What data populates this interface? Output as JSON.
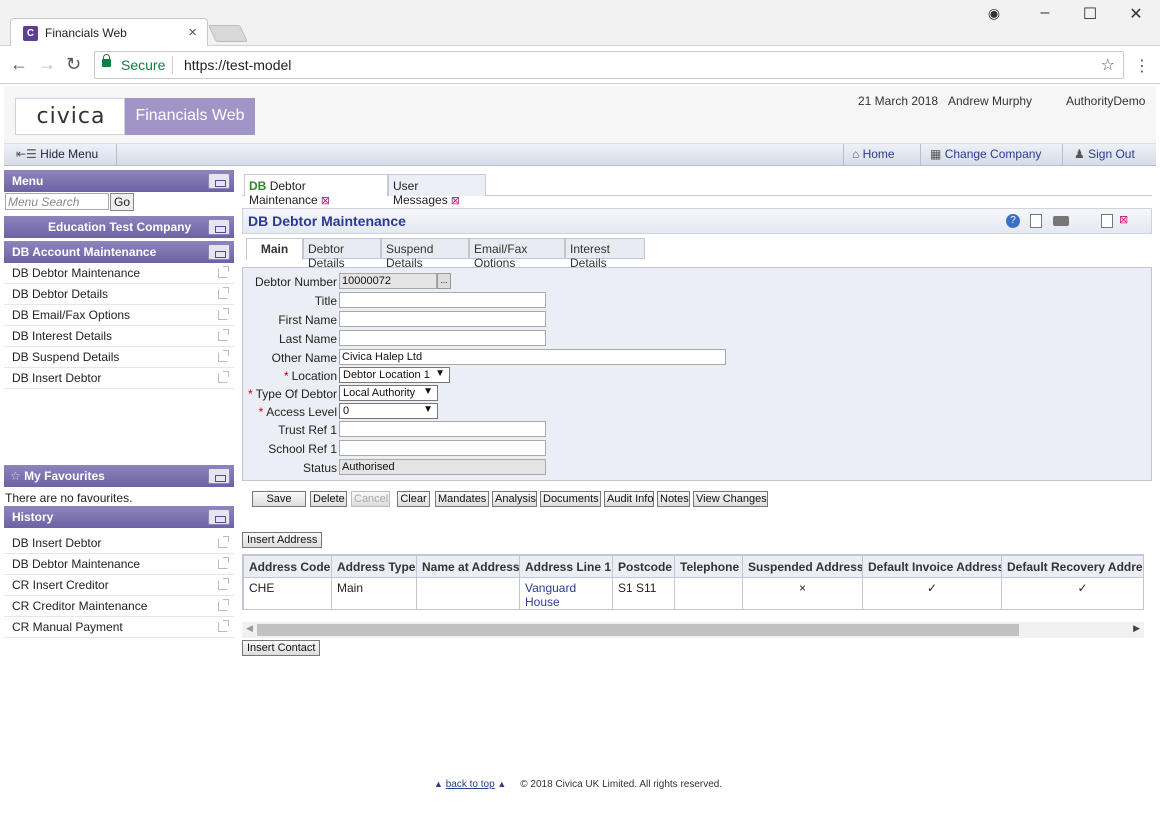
{
  "browser": {
    "tab_title": "Financials Web",
    "tab_favicon_letter": "C",
    "secure_label": "Secure",
    "url": "https://test-model"
  },
  "header": {
    "brand": "civica",
    "product": "Financials Web",
    "date": "21 March 2018",
    "user": "Andrew Murphy",
    "authority": "AuthorityDemo"
  },
  "toolbar": {
    "hide_menu": "Hide Menu",
    "home": "Home",
    "change_company": "Change Company",
    "sign_out": "Sign Out"
  },
  "sidebar": {
    "menu_title": "Menu",
    "search_placeholder": "Menu Search",
    "go_label": "Go",
    "company": "Education Test Company",
    "module": "DB Account Maintenance",
    "items": [
      {
        "label": "DB Debtor Maintenance"
      },
      {
        "label": "DB Debtor Details"
      },
      {
        "label": "DB Email/Fax Options"
      },
      {
        "label": "DB Interest Details"
      },
      {
        "label": "DB Suspend Details"
      },
      {
        "label": "DB Insert Debtor"
      }
    ],
    "favourites_title": "My Favourites",
    "favourites_empty": "There are no favourites.",
    "history_title": "History",
    "history": [
      {
        "label": "DB Insert Debtor"
      },
      {
        "label": "DB Debtor Maintenance"
      },
      {
        "label": "CR Insert Creditor"
      },
      {
        "label": "CR Creditor Maintenance"
      },
      {
        "label": "CR Manual Payment"
      }
    ]
  },
  "doc_tabs": {
    "active_prefix": "DB",
    "active_label": "Debtor Maintenance",
    "other_label": "User Messages"
  },
  "page": {
    "title": "DB Debtor Maintenance",
    "subtabs": [
      "Main",
      "Debtor Details",
      "Suspend Details",
      "Email/Fax Options",
      "Interest Details"
    ]
  },
  "form": {
    "debtor_number": {
      "label": "Debtor Number",
      "value": "10000072",
      "lookup": "..."
    },
    "title": {
      "label": "Title",
      "value": ""
    },
    "first_name": {
      "label": "First Name",
      "value": ""
    },
    "last_name": {
      "label": "Last Name",
      "value": ""
    },
    "other_name": {
      "label": "Other Name",
      "value": "Civica Halep Ltd"
    },
    "location": {
      "label": "Location",
      "value": "Debtor Location 1"
    },
    "type_of_debtor": {
      "label": "Type Of Debtor",
      "value": "Local Authority"
    },
    "access_level": {
      "label": "Access Level",
      "value": "0"
    },
    "trust_ref": {
      "label": "Trust Ref 1",
      "value": ""
    },
    "school_ref": {
      "label": "School Ref 1",
      "value": ""
    },
    "status": {
      "label": "Status",
      "value": "Authorised"
    },
    "required_mark": "*",
    "dropdown_arrow": "▼"
  },
  "actions": {
    "save": "Save",
    "delete": "Delete",
    "cancel": "Cancel",
    "clear": "Clear",
    "mandates": "Mandates",
    "analysis": "Analysis",
    "documents": "Documents",
    "audit_info": "Audit Info",
    "notes": "Notes",
    "view_changes": "View Changes"
  },
  "address": {
    "insert_label": "Insert Address",
    "columns": [
      "Address Code",
      "Address Type",
      "Name at Address",
      "Address Line 1",
      "Postcode",
      "Telephone",
      "Suspended Address",
      "Default Invoice Address",
      "Default Recovery Address"
    ],
    "row": {
      "code": "CHE",
      "type": "Main",
      "name": "",
      "line1": "Vanguard House",
      "postcode": "S1 S11",
      "telephone": "",
      "suspended": "×",
      "default_invoice": "✓",
      "default_recovery": "✓"
    }
  },
  "contact": {
    "insert_label": "Insert Contact"
  },
  "footer": {
    "back_to_top": "back to top",
    "copyright": "© 2018 Civica UK Limited. All rights reserved."
  }
}
